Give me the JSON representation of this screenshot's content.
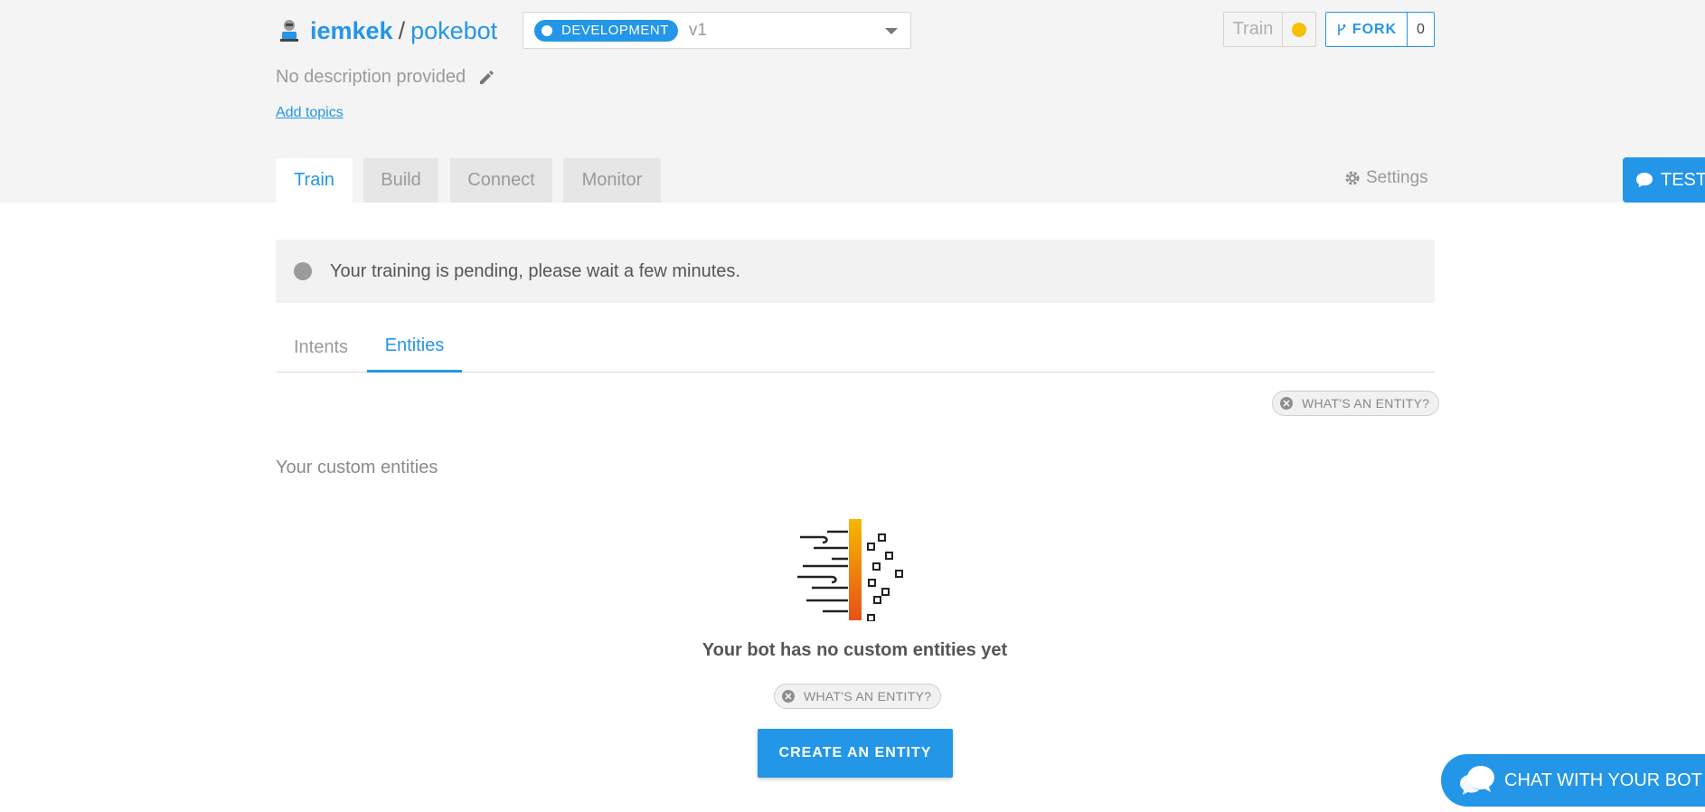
{
  "header": {
    "owner": "iemkek",
    "separator": "/",
    "bot_name": "pokebot",
    "environment": "DEVELOPMENT",
    "version": "v1",
    "train_label": "Train",
    "fork_label": "FORK",
    "fork_count": "0",
    "description": "No description provided",
    "add_topics": "Add topics"
  },
  "tabs": {
    "items": [
      {
        "label": "Train"
      },
      {
        "label": "Build"
      },
      {
        "label": "Connect"
      },
      {
        "label": "Monitor"
      }
    ],
    "settings_label": "Settings",
    "test_label": "TEST"
  },
  "notice": {
    "text": "Your training is pending, please wait a few minutes."
  },
  "subtabs": {
    "items": [
      {
        "label": "Intents"
      },
      {
        "label": "Entities"
      }
    ]
  },
  "entities": {
    "help_pill": "WHAT'S AN ENTITY?",
    "section_title": "Your custom entities",
    "empty_title": "Your bot has no custom entities yet",
    "create_button": "CREATE AN ENTITY"
  },
  "chat": {
    "label": "CHAT WITH YOUR BOT"
  },
  "colors": {
    "accent": "#2396e8",
    "status_yellow": "#f5c000",
    "pending_grey": "#9b9b9b"
  }
}
